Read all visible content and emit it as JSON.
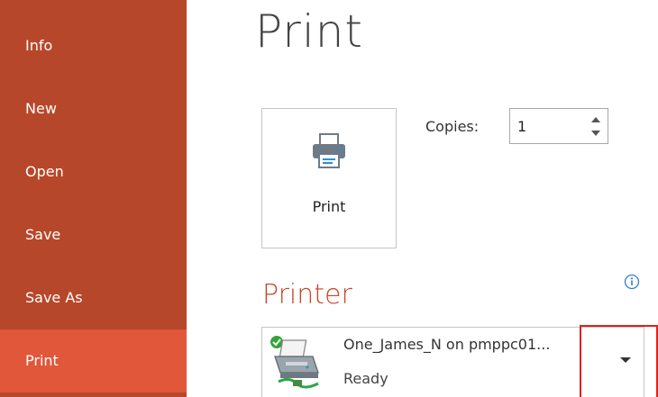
{
  "sidebar": {
    "items": [
      {
        "label": "Info"
      },
      {
        "label": "New"
      },
      {
        "label": "Open"
      },
      {
        "label": "Save"
      },
      {
        "label": "Save As"
      },
      {
        "label": "Print",
        "active": true
      }
    ]
  },
  "main": {
    "title": "Print",
    "print_button": {
      "label": "Print",
      "icon": "printer-icon"
    },
    "copies": {
      "label": "Copies:",
      "value": "1"
    },
    "printer_section": {
      "title": "Printer",
      "info_icon": "info-icon",
      "selected_printer": {
        "name": "One_James_N on pmppc01...",
        "status": "Ready",
        "status_icon": "check-icon"
      }
    }
  },
  "colors": {
    "sidebar_bg": "#b7472a",
    "sidebar_active": "#e0573a",
    "accent": "#c8462a",
    "highlight": "#e0201c"
  }
}
